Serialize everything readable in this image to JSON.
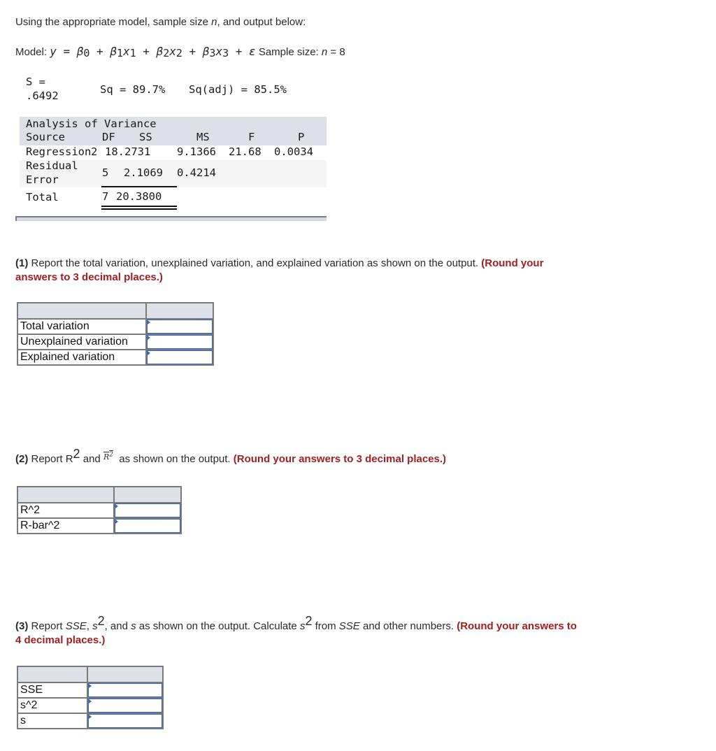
{
  "intro": {
    "text_before": "Using the appropriate model, sample size ",
    "n_var": "n",
    "text_after": ", and output below:"
  },
  "model": {
    "label": "Model: ",
    "y": "y",
    "equals": " = ",
    "terms": [
      "β",
      "0",
      " + β",
      "1",
      "x",
      "1",
      " + β",
      "2",
      "x",
      "2",
      " + β",
      "3",
      "x",
      "3",
      " + ε"
    ],
    "sample_label": "Sample size: ",
    "n_var": "n",
    "sample_value": " = 8"
  },
  "stats": {
    "s_label": "S =",
    "s_value": ".6492",
    "sq": "Sq = 89.7%",
    "sq_adj": "Sq(adj) = 85.5%"
  },
  "anova": {
    "title": "Analysis of Variance",
    "headers": [
      "Source",
      "DF",
      "SS",
      "MS",
      "F",
      "P"
    ],
    "rows": [
      {
        "source": "Regression",
        "df": "2",
        "ss": "18.2731",
        "ms": "9.1366",
        "f": "21.68",
        "p": "0.0034"
      },
      {
        "source_line1": "Residual",
        "source_line2": "Error",
        "df": "5",
        "ss": "2.1069",
        "ms": "0.4214",
        "f": "",
        "p": ""
      },
      {
        "source": "Total",
        "df": "7",
        "ss": "20.3800",
        "ms": "",
        "f": "",
        "p": ""
      }
    ]
  },
  "q1": {
    "number": "(1)",
    "text": " Report the total variation, unexplained variation, and explained variation as shown on the output. ",
    "instruction_line1": "(Round your",
    "instruction_line2": "answers to 3 decimal places.)",
    "rows": [
      {
        "label": "Total variation",
        "value": ""
      },
      {
        "label": "Unexplained variation",
        "value": ""
      },
      {
        "label": "Explained variation",
        "value": ""
      }
    ]
  },
  "q2": {
    "number": "(2)",
    "text_a": " Report R",
    "sup": "2",
    "text_b": " and ",
    "rbar": "R",
    "rbar_sup": "2",
    "text_c": "  as shown on the output. ",
    "instruction": "(Round your answers to 3 decimal places.)",
    "rows": [
      {
        "label": "R^2",
        "value": ""
      },
      {
        "label": "R-bar^2",
        "value": ""
      }
    ]
  },
  "q3": {
    "number": "(3)",
    "text_a": " Report ",
    "sse": "SSE",
    "text_b": ", ",
    "s": "s",
    "sup": "2",
    "text_c": ", and ",
    "s2": "s",
    "text_d": " as shown on the output. Calculate ",
    "s3": "s",
    "sup2": "2",
    "text_e": " from ",
    "sse2": "SSE",
    "text_f": " and other numbers. ",
    "instruction_line1": "(Round your answers to",
    "instruction_line2": "4 decimal places.)",
    "rows": [
      {
        "label": "SSE",
        "value": ""
      },
      {
        "label": "s^2",
        "value": ""
      },
      {
        "label": "s",
        "value": ""
      }
    ]
  }
}
